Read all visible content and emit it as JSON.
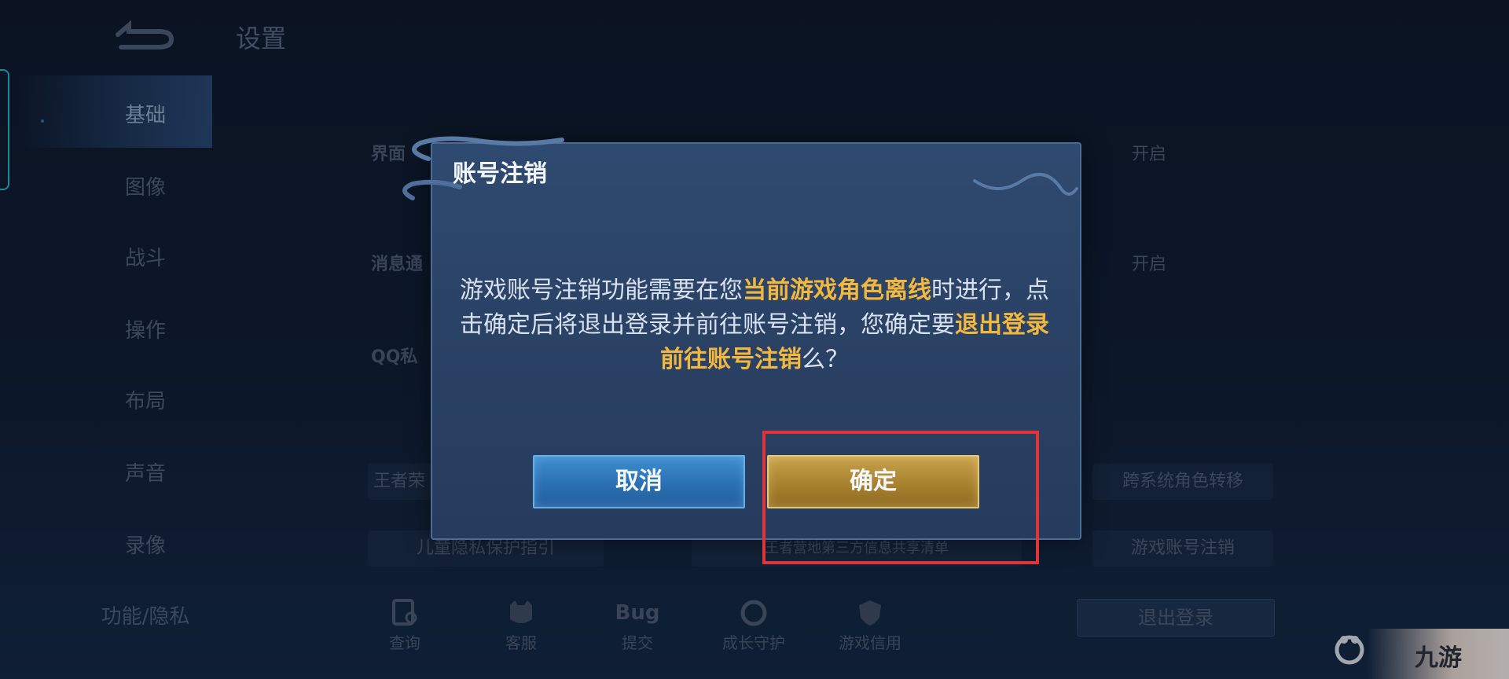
{
  "header": {
    "title": "设置"
  },
  "sidebar": {
    "items": [
      {
        "label": "基础",
        "active": true
      },
      {
        "label": "图像"
      },
      {
        "label": "战斗"
      },
      {
        "label": "操作"
      },
      {
        "label": "布局"
      },
      {
        "label": "声音"
      },
      {
        "label": "录像"
      },
      {
        "label": "功能/隐私"
      }
    ]
  },
  "settings": {
    "row1_label": "界面",
    "row1_value": "开启",
    "row2_label": "消息通",
    "row2_value": "开启",
    "row3_label": "QQ私",
    "row4_label": "王者荣",
    "buttons": {
      "transfer": "跨系统角色转移",
      "child_privacy": "儿童隐私保护指引",
      "third_party": "王者营地第三方信息共享清单",
      "cancel_account": "游戏账号注销"
    },
    "bottom_icons": [
      {
        "label": "查询",
        "icon": "search-doc-icon"
      },
      {
        "label": "客服",
        "icon": "service-cat-icon"
      },
      {
        "label": "提交",
        "icon": "bug-icon",
        "title": "Bug"
      },
      {
        "label": "成长守护",
        "icon": "guard-icon"
      },
      {
        "label": "游戏信用",
        "icon": "credit-shield-icon"
      }
    ],
    "logout": "退出登录"
  },
  "dialog": {
    "title": "账号注销",
    "body_part1": "游戏账号注销功能需要在您",
    "body_hl1": "当前游戏角色离线",
    "body_part2": "时进行，点击确定后将退出登录并前往账号注销，您确定要",
    "body_hl2": "退出登录前往账号注销",
    "body_part3": "么？",
    "cancel_label": "取消",
    "confirm_label": "确定"
  },
  "watermark": {
    "text": "九游"
  },
  "colors": {
    "highlight": "#f2b73f",
    "annotation_box": "#e0333a",
    "cancel_button": "#2a70b3",
    "confirm_button": "#a9822f"
  }
}
